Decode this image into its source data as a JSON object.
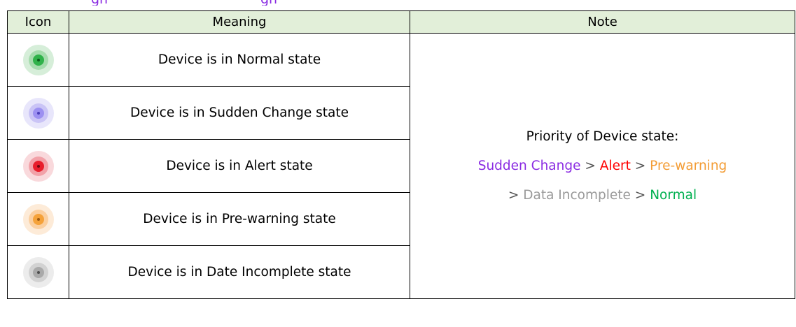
{
  "header": {
    "top_text": [
      "gh",
      "gh"
    ]
  },
  "table": {
    "columns": [
      "Icon",
      "Meaning",
      "Note"
    ],
    "rows": [
      {
        "icon": "normal-state-icon",
        "meaning": "Device is in Normal state",
        "color": "#16a34a"
      },
      {
        "icon": "sudden-change-state-icon",
        "meaning": "Device is in Sudden Change state",
        "color": "#7c6cf0"
      },
      {
        "icon": "alert-state-icon",
        "meaning": "Device is in Alert state",
        "color": "#e81e2c"
      },
      {
        "icon": "pre-warning-state-icon",
        "meaning": "Device is in Pre-warning state",
        "color": "#f5a23a"
      },
      {
        "icon": "data-incomplete-state-icon",
        "meaning": "Device is in Date Incomplete state",
        "color": "#8a8a8a"
      }
    ],
    "note": {
      "title": "Priority of Device state:",
      "items": [
        {
          "label": "Sudden Change",
          "color": "#8a2be2"
        },
        {
          "label": ">",
          "color": "#555555"
        },
        {
          "label": "Alert",
          "color": "#ff0000"
        },
        {
          "label": ">",
          "color": "#555555"
        },
        {
          "label": "Pre-warning",
          "color": "#f39c34"
        },
        {
          "label": ">",
          "color": "#555555"
        },
        {
          "label": "Data Incomplete",
          "color": "#9a9a9a"
        },
        {
          "label": ">",
          "color": "#555555"
        },
        {
          "label": "Normal",
          "color": "#00b050"
        }
      ]
    }
  }
}
